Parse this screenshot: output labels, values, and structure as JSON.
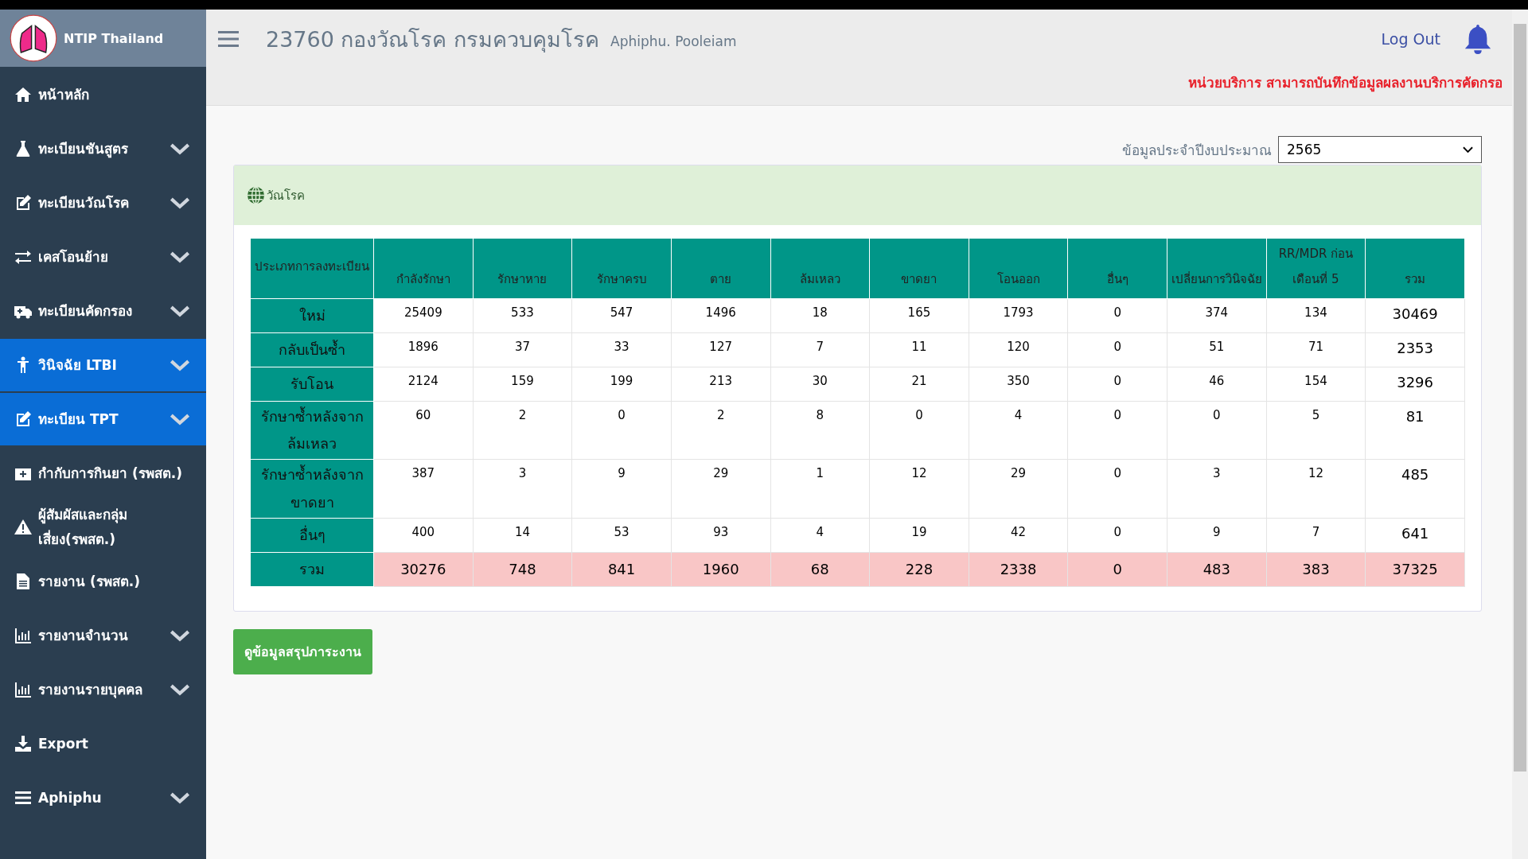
{
  "brand": {
    "name": "NTIP Thailand"
  },
  "header": {
    "title": "23760 กองวัณโรค กรมควบคุมโรค",
    "user": "Aphiphu. Pooleiam",
    "logout": "Log Out",
    "notice": "หน่วยบริการ สามารถบันทึกข้อมูลผลงานบริการคัดกรอ"
  },
  "sidebar": {
    "items": [
      {
        "label": "หน้าหลัก",
        "expandable": false,
        "selected": false
      },
      {
        "label": "ทะเบียนชันสูตร",
        "expandable": true,
        "selected": false
      },
      {
        "label": "ทะเบียนวัณโรค",
        "expandable": true,
        "selected": false
      },
      {
        "label": "เคสโอนย้าย",
        "expandable": true,
        "selected": false
      },
      {
        "label": "ทะเบียนคัดกรอง",
        "expandable": true,
        "selected": false
      },
      {
        "label": "วินิจฉัย LTBI",
        "expandable": true,
        "selected": true
      },
      {
        "label": "ทะเบียน TPT",
        "expandable": true,
        "selected": true
      },
      {
        "label": "กำกับการกินยา (รพสต.)",
        "expandable": false,
        "selected": false
      },
      {
        "label": "ผู้สัมผัสและกลุ่มเสี่ยง(รพสต.)",
        "expandable": false,
        "selected": false
      },
      {
        "label": "รายงาน (รพสต.)",
        "expandable": false,
        "selected": false
      },
      {
        "label": "รายงานจำนวน",
        "expandable": true,
        "selected": false
      },
      {
        "label": "รายงานรายบุคคล",
        "expandable": true,
        "selected": false
      },
      {
        "label": "Export",
        "expandable": false,
        "selected": false
      },
      {
        "label": "Aphiphu",
        "expandable": true,
        "selected": false
      }
    ]
  },
  "year_filter": {
    "label": "ข้อมูลประจำปีงบประมาณ",
    "value": "2565"
  },
  "panel": {
    "title": "วัณโรค"
  },
  "table": {
    "columns": [
      "ประเภทการลงทะเบียน",
      "กำลังรักษา",
      "รักษาหาย",
      "รักษาครบ",
      "ตาย",
      "ล้มเหลว",
      "ขาดยา",
      "โอนออก",
      "อื่นๆ",
      "เปลี่ยนการวินิจฉัย",
      "RR/MDR ก่อนเดือนที่ 5",
      "รวม"
    ],
    "rows": [
      {
        "kind": "data",
        "cells": [
          "ใหม่",
          "25409",
          "533",
          "547",
          "1496",
          "18",
          "165",
          "1793",
          "0",
          "374",
          "134",
          "30469"
        ]
      },
      {
        "kind": "data",
        "cells": [
          "กลับเป็นซ้ำ",
          "1896",
          "37",
          "33",
          "127",
          "7",
          "11",
          "120",
          "0",
          "51",
          "71",
          "2353"
        ]
      },
      {
        "kind": "data",
        "cells": [
          "รับโอน",
          "2124",
          "159",
          "199",
          "213",
          "30",
          "21",
          "350",
          "0",
          "46",
          "154",
          "3296"
        ]
      },
      {
        "kind": "data",
        "cells": [
          "รักษาซ้ำหลังจากล้มเหลว",
          "60",
          "2",
          "0",
          "2",
          "8",
          "0",
          "4",
          "0",
          "0",
          "5",
          "81"
        ]
      },
      {
        "kind": "data",
        "cells": [
          "รักษาซ้ำหลังจากขาดยา",
          "387",
          "3",
          "9",
          "29",
          "1",
          "12",
          "29",
          "0",
          "3",
          "12",
          "485"
        ]
      },
      {
        "kind": "data",
        "cells": [
          "อื่นๆ",
          "400",
          "14",
          "53",
          "93",
          "4",
          "19",
          "42",
          "0",
          "9",
          "7",
          "641"
        ]
      },
      {
        "kind": "total",
        "cells": [
          "รวม",
          "30276",
          "748",
          "841",
          "1960",
          "68",
          "228",
          "2338",
          "0",
          "483",
          "383",
          "37325"
        ]
      }
    ]
  },
  "summary_button": "ดูข้อมูลสรุปภาระงาน"
}
